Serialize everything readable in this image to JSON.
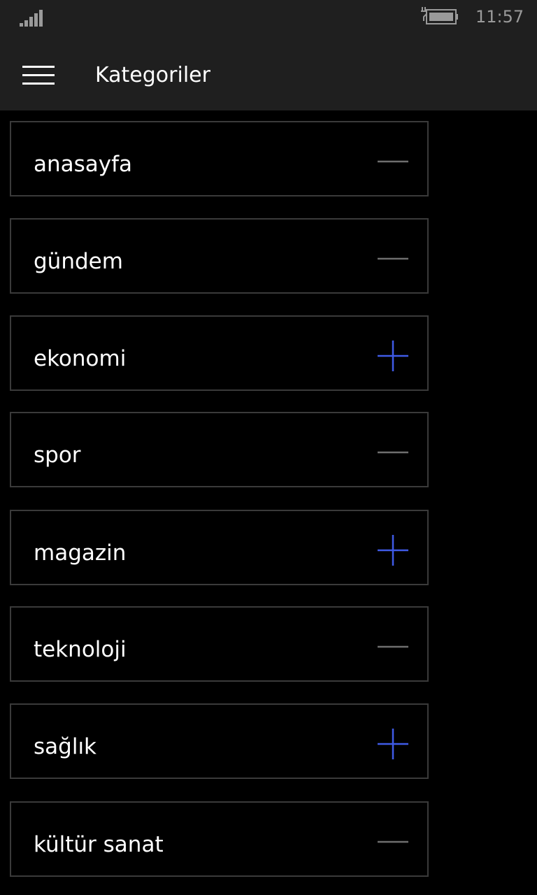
{
  "status_bar": {
    "time": "11:57",
    "signal_icon": "signal-strength-icon",
    "battery_icon": "battery-charging-icon",
    "muted_color": "#9a9a9a"
  },
  "app_bar": {
    "title": "Kategoriler",
    "menu_icon": "hamburger-menu-icon"
  },
  "colors": {
    "background": "#000000",
    "bar_background": "#1f1f1f",
    "border": "#3a3a3a",
    "add_accent": "#3f5be6",
    "remove_gray": "#6e6e6e"
  },
  "categories": [
    {
      "label": "anasayfa",
      "state": "added",
      "icon": "minus-icon"
    },
    {
      "label": "gündem",
      "state": "added",
      "icon": "minus-icon"
    },
    {
      "label": "ekonomi",
      "state": "not-added",
      "icon": "plus-icon"
    },
    {
      "label": "spor",
      "state": "added",
      "icon": "minus-icon"
    },
    {
      "label": "magazin",
      "state": "not-added",
      "icon": "plus-icon"
    },
    {
      "label": "teknoloji",
      "state": "added",
      "icon": "minus-icon"
    },
    {
      "label": "sağlık",
      "state": "not-added",
      "icon": "plus-icon"
    },
    {
      "label": "kültür sanat",
      "state": "added",
      "icon": "minus-icon"
    }
  ]
}
